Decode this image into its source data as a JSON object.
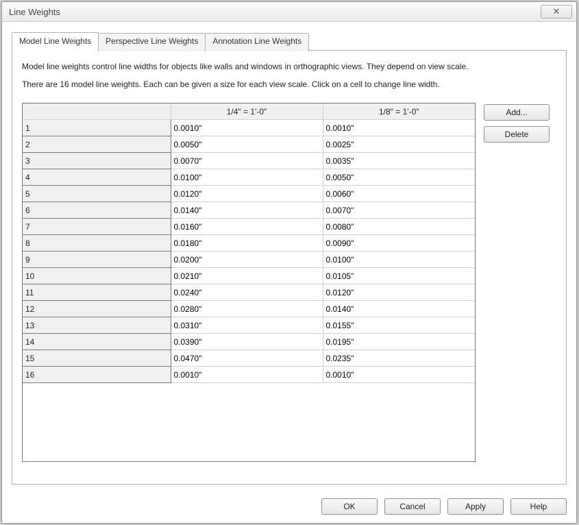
{
  "window": {
    "title": "Line Weights",
    "close_glyph": "✕"
  },
  "tabs": [
    {
      "label": "Model Line Weights",
      "active": true
    },
    {
      "label": "Perspective Line Weights",
      "active": false
    },
    {
      "label": "Annotation Line Weights",
      "active": false
    }
  ],
  "description": {
    "line1": "Model line weights control line widths for objects like walls and windows in orthographic views. They depend on view scale.",
    "line2": "There are 16 model line weights. Each can be given a size for each view scale. Click on a cell to change line width."
  },
  "table": {
    "columns": [
      "",
      "1/4\" = 1'-0\"",
      "1/8\" = 1'-0\""
    ],
    "rows": [
      {
        "n": "1",
        "c1": "0.0010\"",
        "c2": "0.0010\""
      },
      {
        "n": "2",
        "c1": "0.0050\"",
        "c2": "0.0025\""
      },
      {
        "n": "3",
        "c1": "0.0070\"",
        "c2": "0.0035\""
      },
      {
        "n": "4",
        "c1": "0.0100\"",
        "c2": "0.0050\""
      },
      {
        "n": "5",
        "c1": "0.0120\"",
        "c2": "0.0060\""
      },
      {
        "n": "6",
        "c1": "0.0140\"",
        "c2": "0.0070\""
      },
      {
        "n": "7",
        "c1": "0.0160\"",
        "c2": "0.0080\""
      },
      {
        "n": "8",
        "c1": "0.0180\"",
        "c2": "0.0090\""
      },
      {
        "n": "9",
        "c1": "0.0200\"",
        "c2": "0.0100\""
      },
      {
        "n": "10",
        "c1": "0.0210\"",
        "c2": "0.0105\""
      },
      {
        "n": "11",
        "c1": "0.0240\"",
        "c2": "0.0120\""
      },
      {
        "n": "12",
        "c1": "0.0280\"",
        "c2": "0.0140\""
      },
      {
        "n": "13",
        "c1": "0.0310\"",
        "c2": "0.0155\""
      },
      {
        "n": "14",
        "c1": "0.0390\"",
        "c2": "0.0195\""
      },
      {
        "n": "15",
        "c1": "0.0470\"",
        "c2": "0.0235\""
      },
      {
        "n": "16",
        "c1": "0.0010\"",
        "c2": "0.0010\""
      }
    ]
  },
  "side_buttons": {
    "add": "Add...",
    "delete": "Delete"
  },
  "footer": {
    "ok": "OK",
    "cancel": "Cancel",
    "apply": "Apply",
    "help": "Help"
  }
}
